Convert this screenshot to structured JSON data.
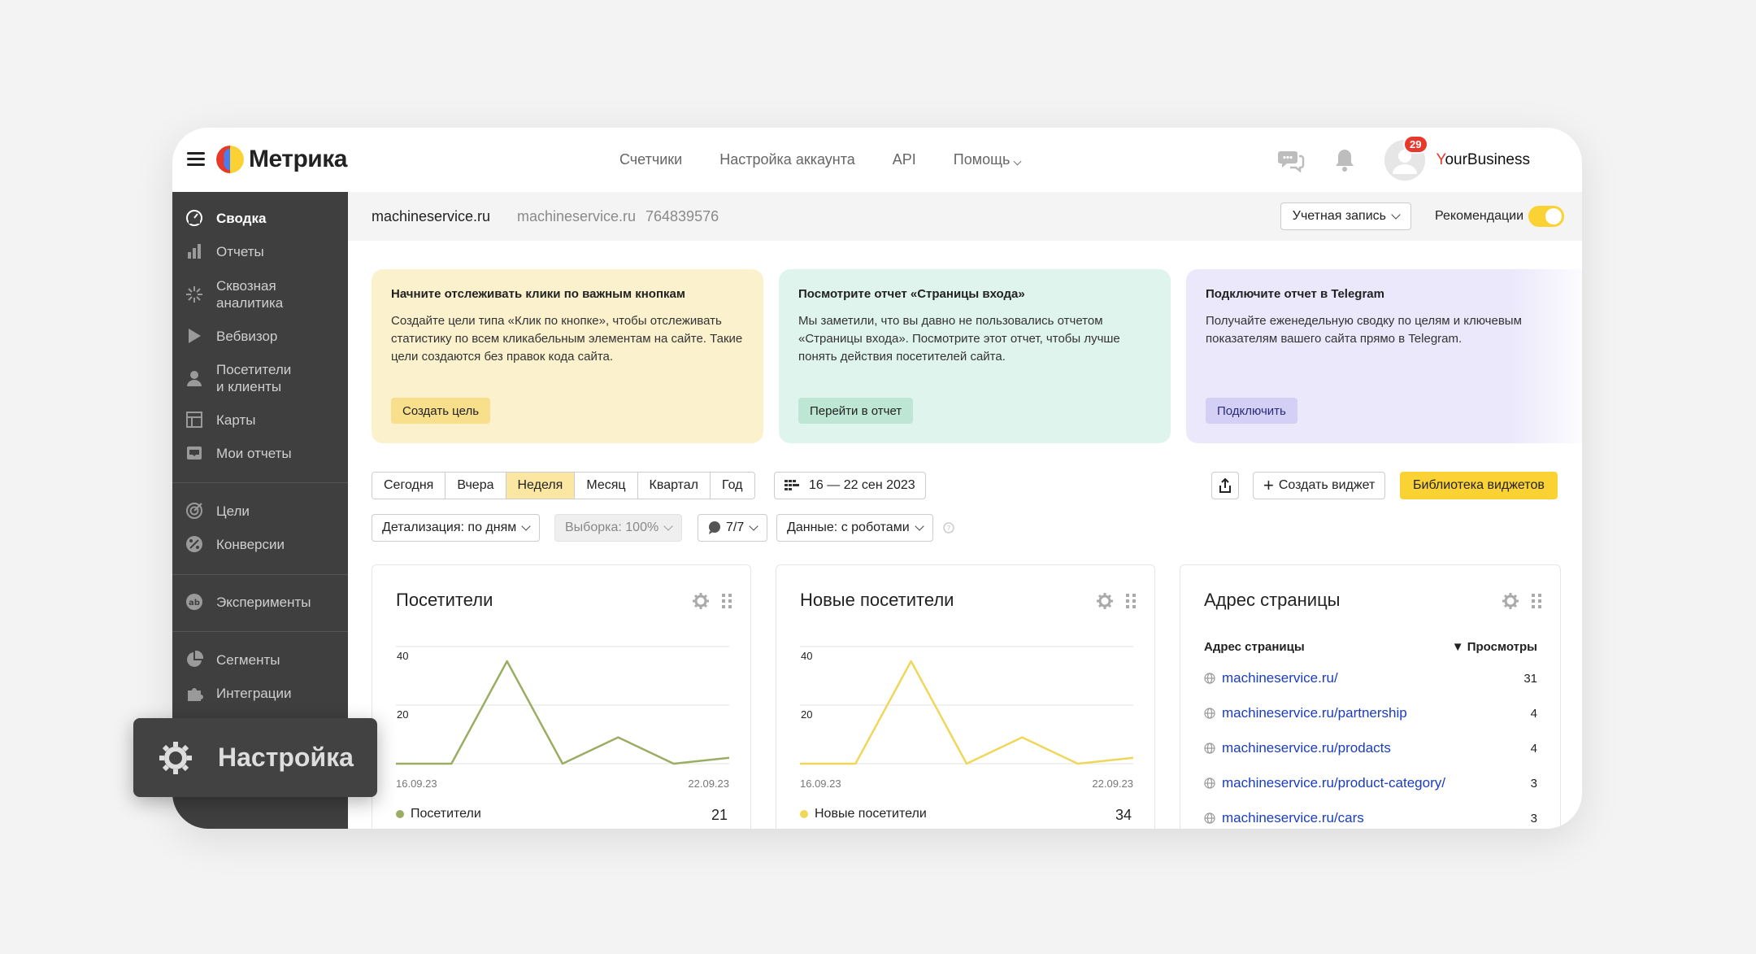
{
  "header": {
    "logo_text": "Метрика",
    "nav": [
      "Счетчики",
      "Настройка аккаунта",
      "API",
      "Помощь"
    ],
    "notification_count": "29",
    "brand_first": "Y",
    "brand_rest": "ourBusiness"
  },
  "sidebar": {
    "items": [
      {
        "label": "Сводка",
        "icon": "dashboard-icon",
        "active": true
      },
      {
        "label": "Отчеты",
        "icon": "bar-chart-icon"
      },
      {
        "label": "Сквозная\nаналитика",
        "icon": "sparkle-icon"
      },
      {
        "label": "Вебвизор",
        "icon": "play-icon"
      },
      {
        "label": "Посетители\nи клиенты",
        "icon": "person-icon"
      },
      {
        "label": "Карты",
        "icon": "map-grid-icon"
      },
      {
        "label": "Мои отчеты",
        "icon": "inbox-icon"
      },
      {
        "label": "Цели",
        "icon": "target-icon"
      },
      {
        "label": "Конверсии",
        "icon": "percent-icon"
      },
      {
        "label": "Эксперименты",
        "icon": "ab-icon"
      },
      {
        "label": "Сегменты",
        "icon": "pie-icon"
      },
      {
        "label": "Интеграции",
        "icon": "puzzle-icon"
      }
    ],
    "settings_label": "Настройка"
  },
  "counter": {
    "site": "machineservice.ru",
    "site_secondary": "machineservice.ru",
    "counter_id": "764839576",
    "account_label": "Учетная запись",
    "recommendations_label": "Рекомендации"
  },
  "cards": [
    {
      "title": "Начните отслеживать клики по важным кнопкам",
      "text": "Создайте цели типа «Клик по кнопке», чтобы отслеживать статистику по всем кликабельным элементам на сайте. Такие цели создаются без правок кода сайта.",
      "button": "Создать цель",
      "bg": "#fbf1cd",
      "btn_bg": "#f7df8b"
    },
    {
      "title": "Посмотрите отчет «Страницы входа»",
      "text": "Мы заметили, что вы давно не пользовались отчетом «Страницы входа». Посмотрите этот отчет, чтобы лучше понять действия посетителей сайта.",
      "button": "Перейти в отчет",
      "bg": "#dff4ec",
      "btn_bg": "#bde6d5"
    },
    {
      "title": "Подключите отчет в Telegram",
      "text": "Получайте еженедельную сводку по целям и ключевым показателям вашего сайта прямо в Telegram.",
      "button": "Подключить",
      "bg": "#ebe8fb",
      "btn_bg": "#d4cff5"
    }
  ],
  "periods": [
    "Сегодня",
    "Вчера",
    "Неделя",
    "Месяц",
    "Квартал",
    "Год"
  ],
  "selected_period": "Неделя",
  "date_range": "16 — 22 сен 2023",
  "create_widget": "Создать виджет",
  "widget_library": "Библиотека виджетов",
  "filters": {
    "detail": "Детализация: по дням",
    "sample": "Выборка: 100%",
    "segment": "7/7",
    "data": "Данные: с роботами"
  },
  "widgets": {
    "visitors": {
      "title": "Посетители",
      "legend": "Посетители",
      "total": "21",
      "color": "#9aad63"
    },
    "new_visitors": {
      "title": "Новые посетители",
      "legend": "Новые посетители",
      "total": "34",
      "color": "#f0d75a"
    },
    "pages": {
      "title": "Адрес страницы",
      "col_url": "Адрес страницы",
      "col_views": "▼ Просмотры",
      "rows": [
        {
          "url": "machineservice.ru/",
          "views": "31"
        },
        {
          "url": "machineservice.ru/partnership",
          "views": "4"
        },
        {
          "url": "machineservice.ru/prodacts",
          "views": "4"
        },
        {
          "url": "machineservice.ru/product-category/",
          "views": "3"
        },
        {
          "url": "machineservice.ru/cars",
          "views": "3"
        }
      ]
    }
  },
  "chart_data": [
    {
      "type": "line",
      "title": "Посетители",
      "x": [
        "16.09.23",
        "17.09.23",
        "18.09.23",
        "19.09.23",
        "20.09.23",
        "21.09.23",
        "22.09.23"
      ],
      "x_tick_labels": [
        "16.09.23",
        "22.09.23"
      ],
      "series": [
        {
          "name": "Посетители",
          "values": [
            0,
            0,
            35,
            0,
            9,
            0,
            2
          ]
        }
      ],
      "ylim": [
        0,
        40
      ],
      "y_ticks": [
        20,
        40
      ],
      "grid": true
    },
    {
      "type": "line",
      "title": "Новые посетители",
      "x": [
        "16.09.23",
        "17.09.23",
        "18.09.23",
        "19.09.23",
        "20.09.23",
        "21.09.23",
        "22.09.23"
      ],
      "x_tick_labels": [
        "16.09.23",
        "22.09.23"
      ],
      "series": [
        {
          "name": "Новые посетители",
          "values": [
            0,
            0,
            35,
            0,
            9,
            0,
            2
          ]
        }
      ],
      "ylim": [
        0,
        40
      ],
      "y_ticks": [
        20,
        40
      ],
      "grid": true
    }
  ]
}
